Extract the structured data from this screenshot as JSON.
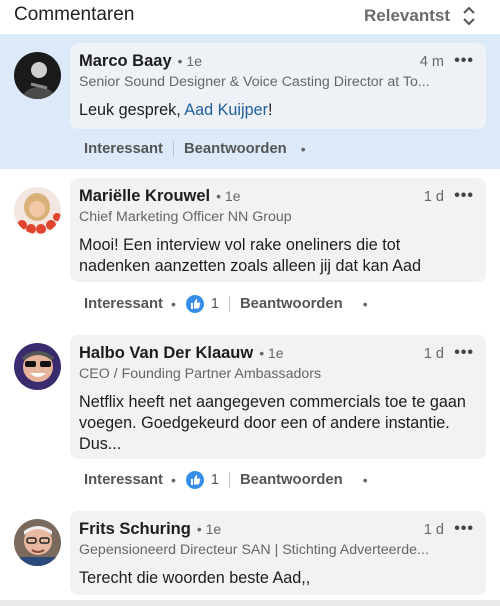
{
  "header": {
    "title": "Commentaren",
    "sort_label": "Relevantst"
  },
  "comments": [
    {
      "name": "Marco Baay",
      "degree": "• 1e",
      "time": "4 m",
      "headline": "Senior Sound Designer & Voice Casting Director at To...",
      "text_before": "Leuk gesprek, ",
      "mention": "Aad Kuijper",
      "text_after": "!",
      "actions": {
        "react": "Interessant",
        "reply": "Beantwoorden"
      }
    },
    {
      "name": "Mariëlle Krouwel",
      "degree": "• 1e",
      "time": "1 d",
      "headline": "Chief Marketing Officer NN Group",
      "text": "Mooi! Een interview vol rake oneliners die tot nadenken aanzetten zoals alleen jij dat kan Aad",
      "like_count": "1",
      "actions": {
        "react": "Interessant",
        "reply": "Beantwoorden"
      }
    },
    {
      "name": "Halbo Van Der Klaauw",
      "degree": "• 1e",
      "time": "1 d",
      "headline": "CEO / Founding Partner Ambassadors",
      "text": "Netflix heeft net aangegeven commercials toe te gaan voegen. Goedgekeurd door een of andere instantie. Dus...",
      "like_count": "1",
      "actions": {
        "react": "Interessant",
        "reply": "Beantwoorden"
      }
    },
    {
      "name": "Frits Schuring",
      "degree": "• 1e",
      "time": "1 d",
      "headline": "Gepensioneerd Directeur SAN | Stichting Adverteerde...",
      "text": "Terecht die woorden beste Aad,,"
    }
  ],
  "icons": {
    "sort": "sort-updown-icon",
    "more": "more-horizontal-icon",
    "like": "thumbs-up-icon"
  },
  "colors": {
    "highlight_bg": "#dce9f8",
    "bubble_bg": "#f2f2f2",
    "link": "#1f5f9c",
    "like_blue": "#378fe9"
  }
}
